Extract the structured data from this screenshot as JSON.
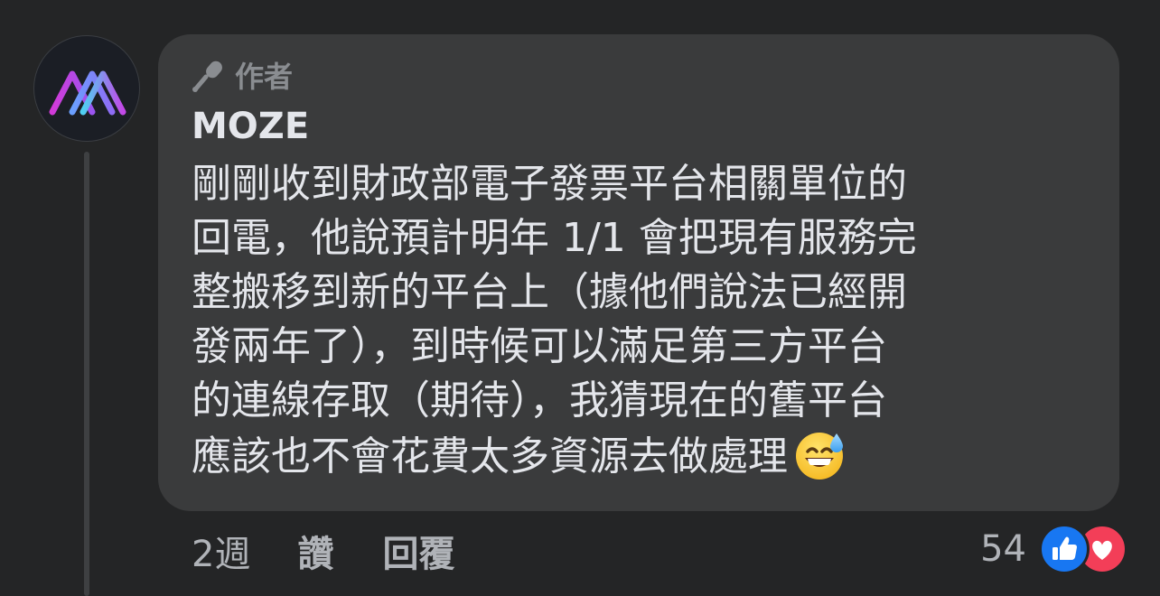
{
  "author_badge": {
    "label": "作者",
    "icon": "microphone-icon"
  },
  "author_name": "MOZE",
  "avatar_icon": "moze-logo",
  "comment_lines": [
    "剛剛收到財政部電子發票平台相關單位的",
    "回電，他說預計明年 1/1 會把現有服務完",
    "整搬移到新的平台上（據他們說法已經開",
    "發兩年了），到時候可以滿足第三方平台",
    "的連線存取（期待），我猜現在的舊平台",
    "應該也不會花費太多資源去做處理"
  ],
  "comment_emoji": "grinning-face-with-sweat-emoji",
  "actions": {
    "time": "2週",
    "like": "讚",
    "reply": "回覆"
  },
  "reactions": {
    "count": "54",
    "types": [
      "like-icon",
      "love-icon"
    ]
  },
  "colors": {
    "background": "#242526",
    "bubble": "#3a3b3c",
    "text_primary": "#e4e6eb",
    "text_secondary": "#b0b3b8",
    "like_blue": "#1877f2",
    "love_red": "#f33e58"
  }
}
